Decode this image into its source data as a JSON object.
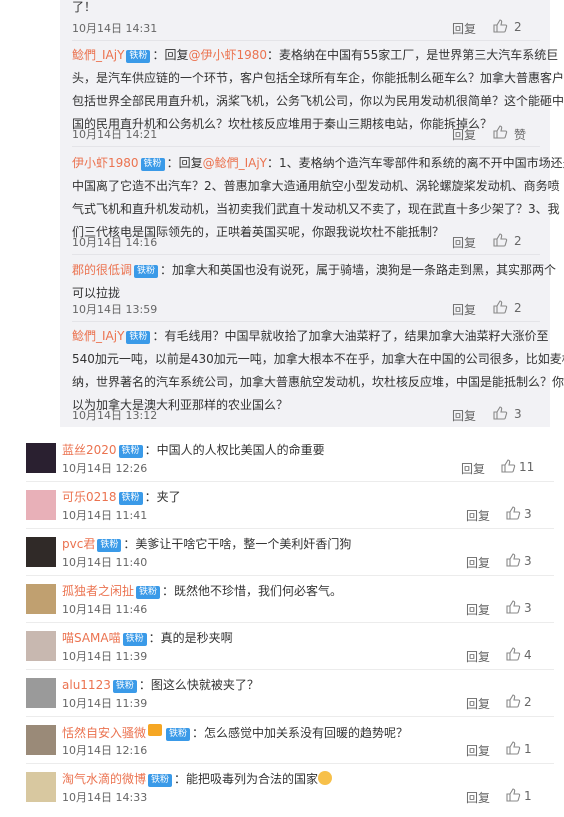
{
  "icons": {
    "like": "thumbs-up-icon"
  },
  "labels": {
    "reply": "回复"
  },
  "sub_replies": [
    {
      "id": "s0",
      "lines": [
        "了！"
      ],
      "time": "10月14日 14:31",
      "likes": "2"
    },
    {
      "id": "s1",
      "user": "鲶們_IAjY",
      "badge": "铁粉",
      "reply_prefix": "：回复",
      "reply_to": "@伊小虾1980",
      "lines_first": "：麦格纳在中国有55家工厂，是世界第三大汽车系统巨",
      "lines": [
        "头，是汽车供应链的一个环节，客户包括全球所有车企，你能抵制么砸车么？加拿大普惠客户",
        "包括世界全部民用直升机，涡桨飞机，公务飞机公司，你以为民用发动机很简单？这个能砸中",
        "国的民用直升机和公务机么？坎杜核反应堆用于秦山三期核电站，你能拆掉么？"
      ],
      "time": "10月14日 14:21",
      "likes": "赞"
    },
    {
      "id": "s2",
      "user": "伊小虾1980",
      "badge": "铁粉",
      "reply_prefix": "：回复",
      "reply_to": "@鲶們_IAjY",
      "lines_first": "：1、麦格纳个造汽车零部件和系统的离不开中国市场还是",
      "lines": [
        "中国离了它造不出汽车？2、普惠加拿大造通用航空小型发动机、涡轮螺旋桨发动机、商务喷",
        "气式飞机和直升机发动机，当初卖我们武直十发动机又不卖了，现在武直十多少架了？3、我",
        "们三代核电是国际领先的，正哄着英国买呢，你跟我说坎杜不能抵制？"
      ],
      "time": "10月14日 14:16",
      "likes": "2"
    },
    {
      "id": "s3",
      "user": "郡的很低调",
      "badge": "铁粉",
      "lines_first": "：加拿大和英国也没有说死，属于骑墙，澳狗是一条路走到黑，其实那两个",
      "lines": [
        "可以拉拢"
      ],
      "time": "10月14日 13:59",
      "likes": "2"
    },
    {
      "id": "s4",
      "user": "鲶們_IAjY",
      "badge": "铁粉",
      "lines_first": "：有毛线用？中国早就收拾了加拿大油菜籽了，结果加拿大油菜籽大涨价至",
      "lines": [
        "540加元一吨，以前是430加元一吨，加拿大根本不在乎，加拿大在中国的公司很多，比如麦格",
        "纳，世界著名的汽车系统公司，加拿大普惠航空发动机，坎杜核反应堆，中国是能抵制么？你",
        "以为加拿大是澳大利亚那样的农业国么？"
      ],
      "time": "10月14日 13:12",
      "likes": "3"
    }
  ],
  "comments": [
    {
      "id": "c0",
      "user": "蓝丝2020",
      "badge": "铁粉",
      "text": "：中国人的人权比美国人的命重要",
      "time": "10月14日 12:26",
      "likes": "11",
      "avatar": "#2a2030"
    },
    {
      "id": "c1",
      "user": "可乐0218",
      "badge": "铁粉",
      "text": "：夹了",
      "time": "10月14日 11:41",
      "likes": "3",
      "avatar": "#e8b0b8"
    },
    {
      "id": "c2",
      "user": "pvc君",
      "badge": "铁粉",
      "text": "：美爹让干啥它干啥，整一个美利奸香门狗",
      "time": "10月14日 11:40",
      "likes": "3",
      "avatar": "#302a28"
    },
    {
      "id": "c3",
      "user": "孤独者之闲扯",
      "badge": "铁粉",
      "text": "：既然他不珍惜，我们何必客气。",
      "time": "10月14日 11:46",
      "likes": "3",
      "avatar": "#c0a070"
    },
    {
      "id": "c4",
      "user": "喵SAMA喵",
      "badge": "铁粉",
      "text": "：真的是秒夹啊",
      "time": "10月14日 11:39",
      "likes": "4",
      "avatar": "#c8b8b0"
    },
    {
      "id": "c5",
      "user": "alu1123",
      "badge": "铁粉",
      "text": "：图这么快就被夹了？",
      "time": "10月14日 11:39",
      "likes": "2",
      "avatar": "#9a9a9a"
    },
    {
      "id": "c6",
      "user": "恬然自安入骚微",
      "badge": "铁粉",
      "text": "：怎么感觉中加关系没有回暖的趋势呢？",
      "time": "10月14日 12:16",
      "likes": "1",
      "avatar": "#9a8a78"
    },
    {
      "id": "c7",
      "user": "淘气水滴的微博",
      "badge": "铁粉",
      "text": "：能把吸毒列为合法的国家",
      "time": "10月14日 14:33",
      "likes": "1",
      "avatar": "#d8c8a0"
    }
  ]
}
